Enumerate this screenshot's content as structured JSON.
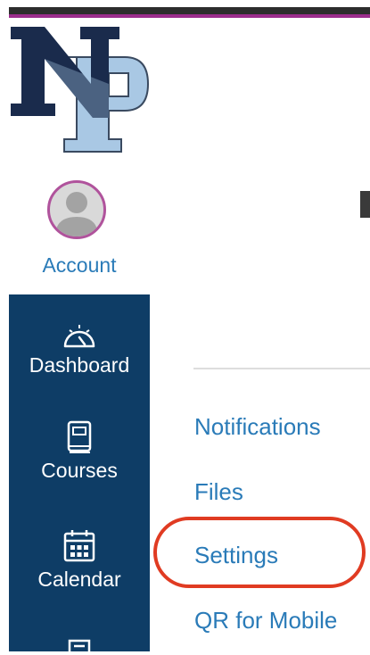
{
  "logo": {
    "icon": "np-school-logo",
    "letters": "NP",
    "colors": {
      "navy": "#1a2b4c",
      "lightblue": "#a9c8e4"
    }
  },
  "account": {
    "label": "Account",
    "avatar_icon": "user-avatar-icon"
  },
  "nav": {
    "background": "#0e3d66",
    "items": [
      {
        "label": "Dashboard",
        "icon": "speedometer-icon"
      },
      {
        "label": "Courses",
        "icon": "book-icon"
      },
      {
        "label": "Calendar",
        "icon": "calendar-icon"
      },
      {
        "label": "",
        "icon": "inbox-icon"
      }
    ]
  },
  "account_menu": {
    "links": [
      {
        "label": "Notifications"
      },
      {
        "label": "Files"
      },
      {
        "label": "Settings",
        "highlighted": true
      },
      {
        "label": "QR for Mobile"
      }
    ],
    "link_color": "#2a7bb8",
    "highlight_color": "#e03b22"
  }
}
